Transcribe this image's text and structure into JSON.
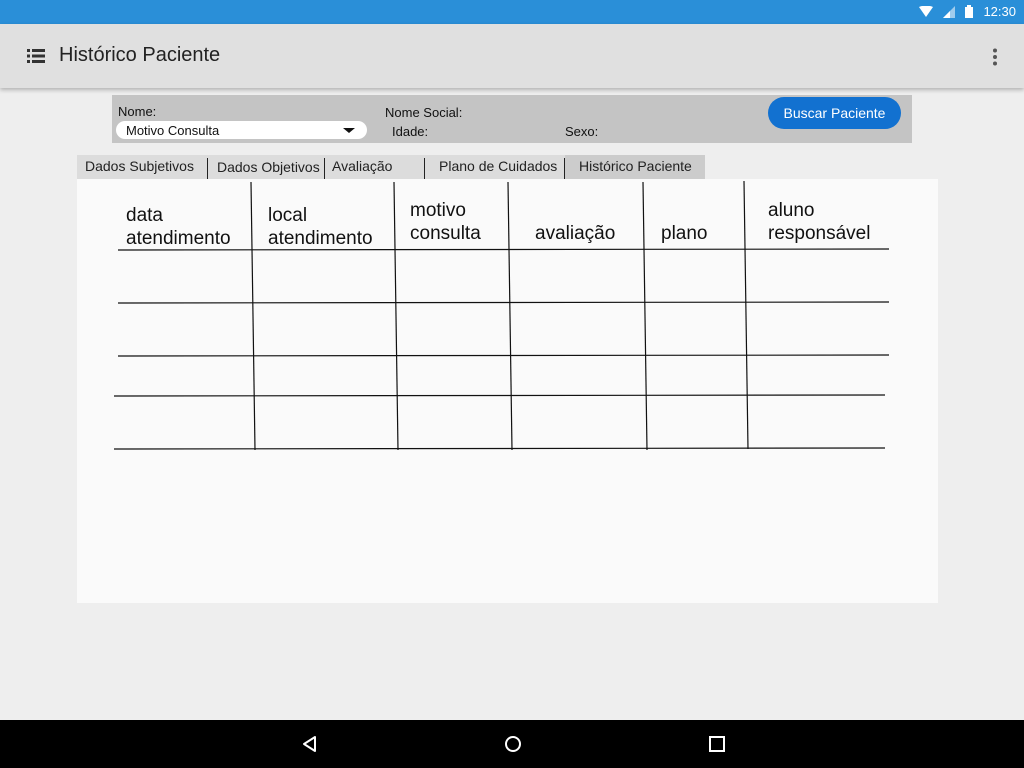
{
  "status_bar": {
    "time": "12:30",
    "icons": [
      "wifi-icon",
      "signal-icon",
      "battery-icon"
    ]
  },
  "app_bar": {
    "title": "Histórico Paciente",
    "icons": [
      "list-menu-icon",
      "more-vert-icon"
    ]
  },
  "patient": {
    "nome_label": "Nome:",
    "nome_social_label": "Nome Social:",
    "idade_label": "Idade:",
    "sexo_label": "Sexo:",
    "dropdown_value": "Motivo Consulta",
    "buscar_button": "Buscar Paciente"
  },
  "tabs": [
    {
      "label": "Dados Subjetivos"
    },
    {
      "label": "Dados Objetivos"
    },
    {
      "label": "Avaliação"
    },
    {
      "label": "Plano de Cuidados"
    },
    {
      "label": "Histórico Paciente",
      "active": true
    }
  ],
  "table": {
    "columns": [
      {
        "line1": "data",
        "line2": "atendimento"
      },
      {
        "line1": "local",
        "line2": "atendimento"
      },
      {
        "line1": "motivo",
        "line2": "consulta"
      },
      {
        "line1": "",
        "line2": "avaliação"
      },
      {
        "line1": "",
        "line2": "plano"
      },
      {
        "line1": "aluno",
        "line2": "responsável"
      }
    ],
    "rows": [
      [
        "",
        "",
        "",
        "",
        "",
        ""
      ],
      [
        "",
        "",
        "",
        "",
        "",
        ""
      ],
      [
        "",
        "",
        "",
        "",
        "",
        ""
      ],
      [
        "",
        "",
        "",
        "",
        "",
        ""
      ]
    ]
  },
  "nav_bar": {
    "icons": [
      "back-icon",
      "home-icon",
      "recents-icon"
    ]
  },
  "colors": {
    "status_bar": "#2a8fd8",
    "button": "#1271d0"
  }
}
